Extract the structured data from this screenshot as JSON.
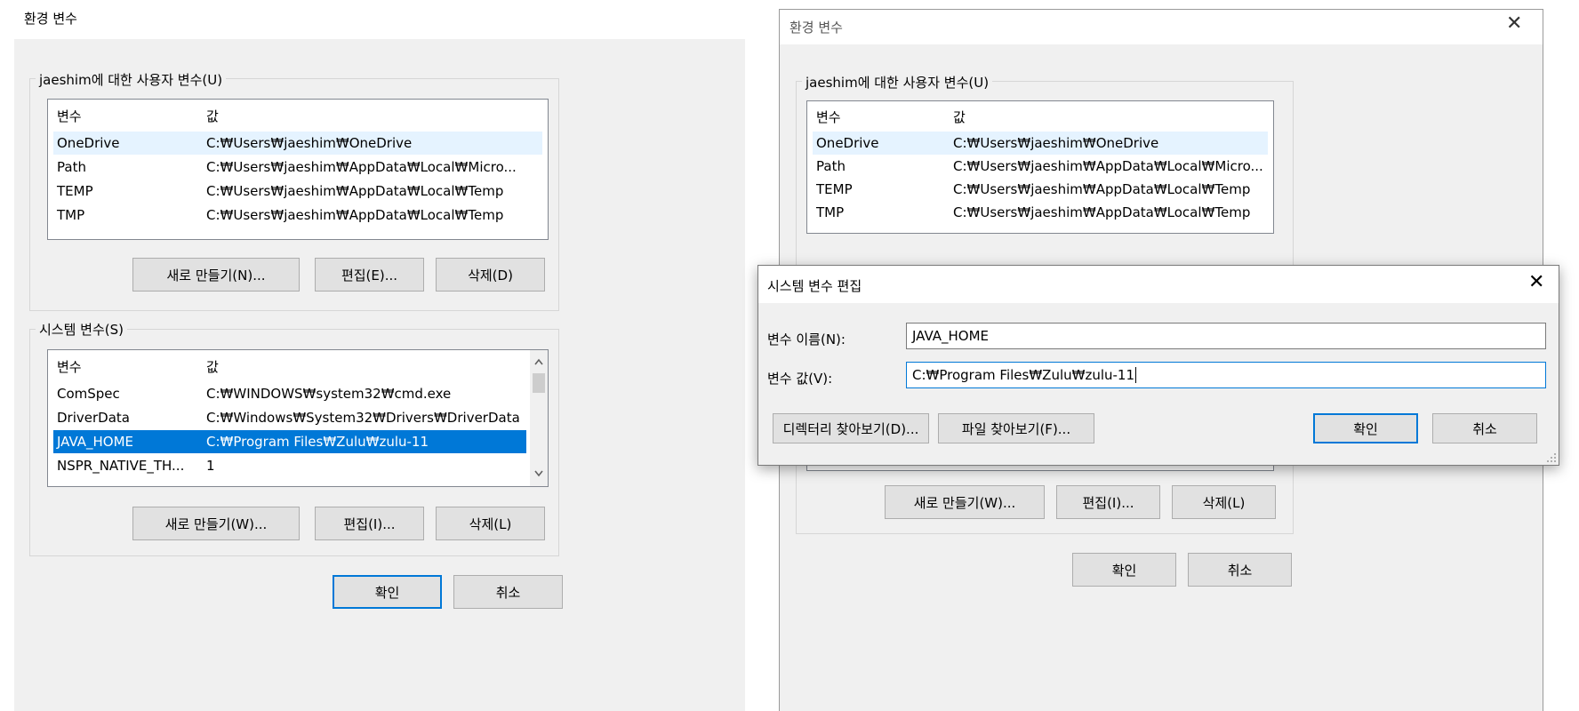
{
  "left_window": {
    "title": "환경 변수",
    "user_group_label": "jaeshim에 대한 사용자 변수(U)",
    "user_headers": {
      "name": "변수",
      "value": "값"
    },
    "user_rows": [
      {
        "name": "OneDrive",
        "value": "C:₩Users₩jaeshim₩OneDrive"
      },
      {
        "name": "Path",
        "value": "C:₩Users₩jaeshim₩AppData₩Local₩Micro..."
      },
      {
        "name": "TEMP",
        "value": "C:₩Users₩jaeshim₩AppData₩Local₩Temp"
      },
      {
        "name": "TMP",
        "value": "C:₩Users₩jaeshim₩AppData₩Local₩Temp"
      }
    ],
    "user_buttons": {
      "new": "새로 만들기(N)...",
      "edit": "편집(E)...",
      "delete": "삭제(D)"
    },
    "system_group_label": "시스템 변수(S)",
    "system_headers": {
      "name": "변수",
      "value": "값"
    },
    "system_rows": [
      {
        "name": "ComSpec",
        "value": "C:₩WINDOWS₩system32₩cmd.exe"
      },
      {
        "name": "DriverData",
        "value": "C:₩Windows₩System32₩Drivers₩DriverData"
      },
      {
        "name": "JAVA_HOME",
        "value": "C:₩Program Files₩Zulu₩zulu-11"
      },
      {
        "name": "NSPR_NATIVE_TH...",
        "value": "1"
      }
    ],
    "system_buttons": {
      "new": "새로 만들기(W)...",
      "edit": "편집(I)...",
      "delete": "삭제(L)"
    },
    "ok": "확인",
    "cancel": "취소"
  },
  "right_window": {
    "title": "환경 변수",
    "close_glyph": "✕",
    "user_group_label": "jaeshim에 대한 사용자 변수(U)",
    "user_headers": {
      "name": "변수",
      "value": "값"
    },
    "user_rows": [
      {
        "name": "OneDrive",
        "value": "C:₩Users₩jaeshim₩OneDrive"
      },
      {
        "name": "Path",
        "value": "C:₩Users₩jaeshim₩AppData₩Local₩Micro..."
      },
      {
        "name": "TEMP",
        "value": "C:₩Users₩jaeshim₩AppData₩Local₩Temp"
      },
      {
        "name": "TMP",
        "value": "C:₩Users₩jaeshim₩AppData₩Local₩Temp"
      }
    ],
    "system_buttons": {
      "new": "새로 만들기(W)...",
      "edit": "편집(I)...",
      "delete": "삭제(L)"
    },
    "ok": "확인",
    "cancel": "취소"
  },
  "edit_dialog": {
    "title": "시스템 변수 편집",
    "close_glyph": "✕",
    "name_label": "변수 이름(N):",
    "name_value": "JAVA_HOME",
    "value_label": "변수 값(V):",
    "value_value": "C:₩Program Files₩Zulu₩zulu-11",
    "browse_dir": "디렉터리 찾아보기(D)...",
    "browse_file": "파일 찾아보기(F)...",
    "ok": "확인",
    "cancel": "취소"
  },
  "colors": {
    "selection": "#0078d7",
    "hover": "#e5f3ff",
    "window_bg": "#f0f0f0"
  },
  "icons": {
    "scroll_up": "chevron-up-icon",
    "scroll_down": "chevron-down-icon",
    "close": "close-icon"
  }
}
